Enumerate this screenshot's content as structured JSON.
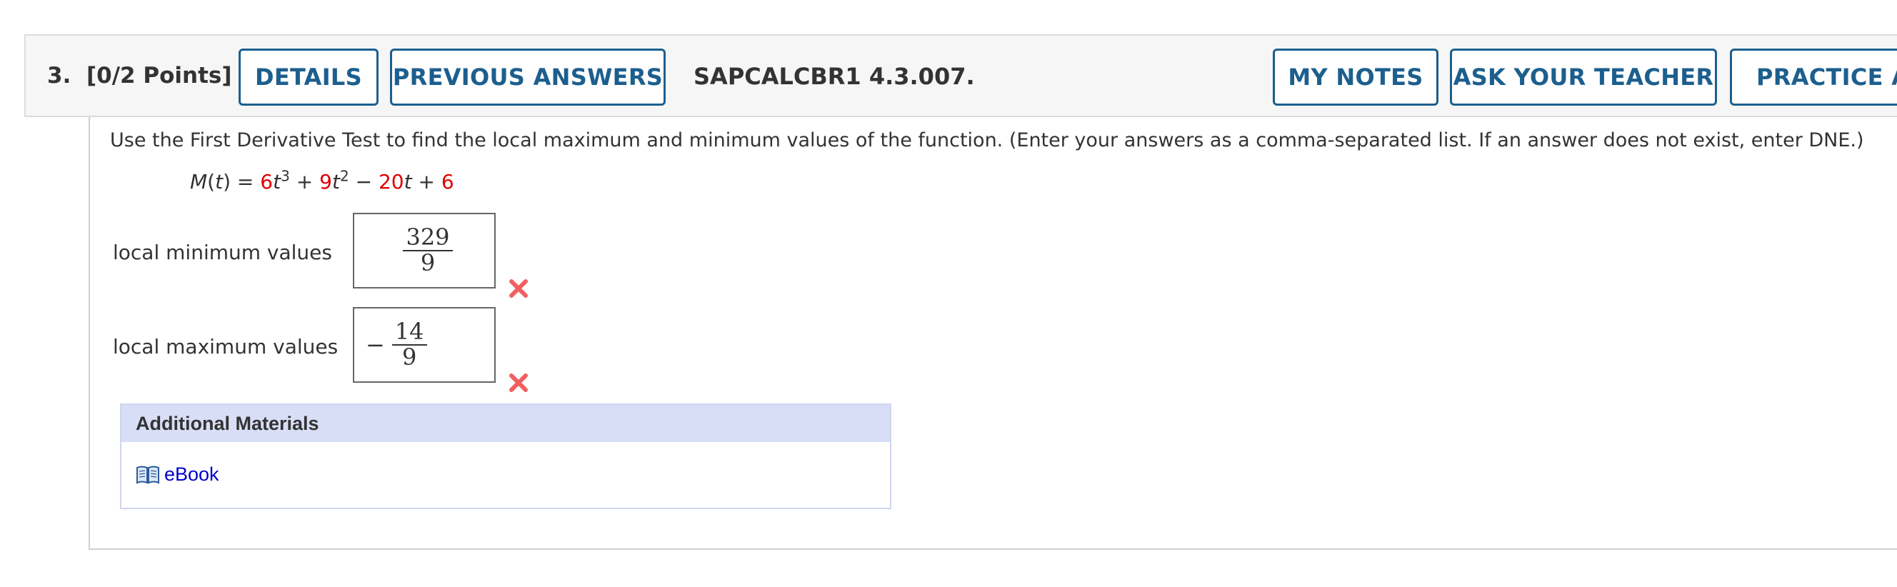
{
  "header": {
    "question_number": "3.",
    "points": "[0/2 Points]",
    "details_label": "DETAILS",
    "previous_answers_label": "PREVIOUS ANSWERS",
    "problem_code": "SAPCALCBR1 4.3.007.",
    "my_notes_label": "MY NOTES",
    "ask_teacher_label": "ASK YOUR TEACHER",
    "practice_label": "PRACTICE AN"
  },
  "question": {
    "instructions": "Use the First Derivative Test to find the local maximum and minimum values of the function. (Enter your answers as a comma-separated list. If an answer does not exist, enter DNE.)",
    "function": {
      "name": "M",
      "variable": "t",
      "equals": "=",
      "c3": "6",
      "exp3": "3",
      "plus1": "+",
      "c2": "9",
      "exp2": "2",
      "minus": "−",
      "c1": "20",
      "plus2": "+",
      "c0": "6"
    }
  },
  "answers": [
    {
      "label": "local minimum values",
      "sign": "",
      "numerator": "329",
      "denominator": "9",
      "status": "incorrect"
    },
    {
      "label": "local maximum values",
      "sign": "−",
      "numerator": "14",
      "denominator": "9",
      "status": "incorrect"
    }
  ],
  "additional_materials": {
    "title": "Additional Materials",
    "ebook_label": "eBook",
    "ebook_icon": "book-icon"
  },
  "colors": {
    "button_border": "#1c5f8e",
    "coefficient": "#e00000",
    "incorrect_mark": "#f06060",
    "materials_header": "#d8def6",
    "link": "#0000cc"
  }
}
